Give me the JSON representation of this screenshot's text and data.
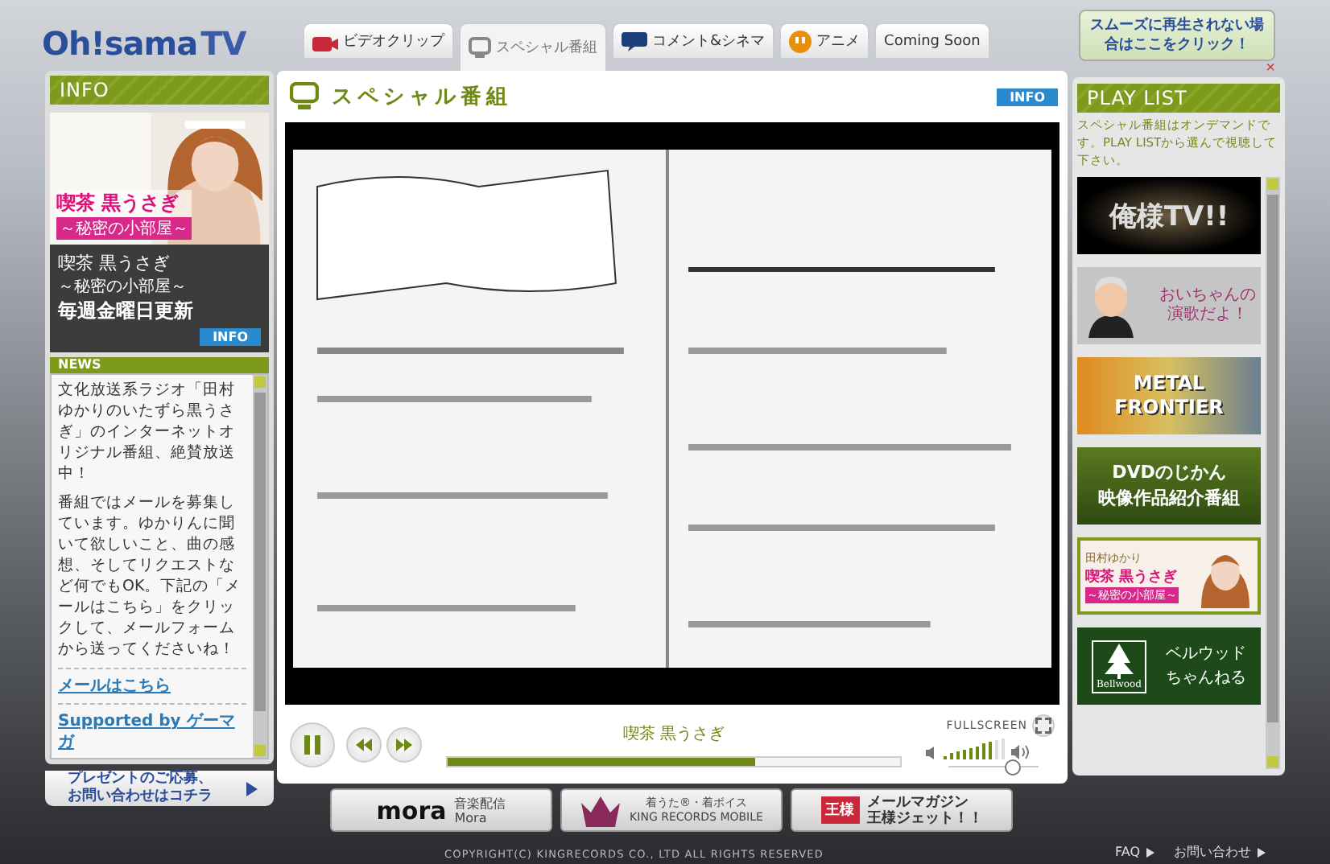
{
  "logo": {
    "main": "Oh!sama",
    "tv": "TV"
  },
  "tabs": [
    {
      "label": "ビデオクリップ",
      "kind": "camera",
      "selected": false
    },
    {
      "label": "スペシャル番組",
      "kind": "monitor",
      "selected": true
    },
    {
      "label": "コメント&シネマ",
      "kind": "bubble",
      "selected": false
    },
    {
      "label": "アニメ",
      "kind": "smiley",
      "selected": false
    },
    {
      "label": "Coming Soon",
      "kind": "none",
      "selected": false
    }
  ],
  "notice": {
    "text": "スムーズに再生されない場合はここをクリック！",
    "close": "×"
  },
  "info_panel": {
    "title": "INFO",
    "banner": {
      "prefix": "喫茶",
      "title": "黒うさぎ",
      "subtitle": "～秘密の小部屋～"
    },
    "caption": {
      "prefix": "喫茶",
      "title": "黒うさぎ",
      "subtitle": "～秘密の小部屋～",
      "schedule": "毎週金曜日更新"
    },
    "info_button": "INFO"
  },
  "news": {
    "title": "NEWS",
    "paragraphs": [
      "文化放送系ラジオ「田村ゆかりのいたずら黒うさぎ」のインターネットオリジナル番組、絶賛放送中！",
      "番組ではメールを募集しています。ゆかりんに聞いて欲しいこと、曲の感想、そしてリクエストなど何でもOK。下記の「メールはこちら」をクリックして、メールフォームから送ってくださいね！"
    ],
    "links": [
      "メールはこちら",
      "Supported by ゲーマガ"
    ]
  },
  "present_link": {
    "line1": "プレゼントのご応募、",
    "line2": "お問い合わせはコチラ"
  },
  "player": {
    "title": "スペシャル番組",
    "info_button": "INFO",
    "now_playing": "喫茶 黒うさぎ",
    "fullscreen": "FULLSCREEN",
    "playing": true,
    "progress": {
      "level": 0.68
    },
    "volume": {
      "level": 0.72
    }
  },
  "playlist": {
    "title": "PLAY LIST",
    "description": "スペシャル番組はオンデマンドです。PLAY LISTから選んで視聴して下さい。",
    "items": [
      {
        "kind": "dark",
        "lines": [
          "俺様TV!!"
        ]
      },
      {
        "kind": "caricature",
        "lines": [
          "おいちゃんの",
          "演歌だよ！"
        ]
      },
      {
        "kind": "metal",
        "lines": [
          "METAL",
          "FRONTIER"
        ]
      },
      {
        "kind": "green",
        "lines": [
          "DVDのじかん",
          "映像作品紹介番組"
        ]
      },
      {
        "kind": "portrait",
        "lines": [
          "田村ゆかり",
          "喫茶 黒うさぎ",
          "～秘密の小部屋～"
        ]
      },
      {
        "kind": "bellwood",
        "lines": [
          "Bellwood",
          "ベルウッド",
          "ちゃんねる"
        ]
      }
    ]
  },
  "banners": [
    {
      "kind": "mora",
      "logo": "mora",
      "lines": [
        "音楽配信",
        "Mora"
      ]
    },
    {
      "kind": "crown",
      "lines": [
        "着うた®・着ボイス",
        "KING RECORDS MOBILE"
      ]
    },
    {
      "kind": "mail",
      "logo": "王様",
      "lines": [
        "メールマガジン",
        "王様ジェット！！"
      ]
    }
  ],
  "footer": {
    "copyright": "COPYRIGHT(C) KINGRECORDS CO., LTD ALL RIGHTS RESERVED",
    "links": [
      "FAQ",
      "お問い合わせ"
    ]
  }
}
